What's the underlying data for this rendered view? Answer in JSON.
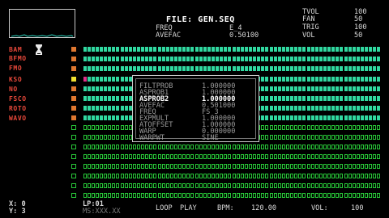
{
  "file": {
    "label": "FILE:",
    "name": "GEN.SEQ"
  },
  "header": {
    "freq_label": "FREQ",
    "freq_value": "E_4",
    "avefac_label": "AVEFAC",
    "avefac_value": "0.50100",
    "tvol_label": "TVOL",
    "tvol_value": "100",
    "fan_label": "FAN",
    "fan_value": "50",
    "trig_label": "TRIG",
    "trig_value": "100",
    "vol_label": "VOL",
    "vol_value": "50"
  },
  "tracks": [
    {
      "name": "BAM",
      "led": "#e07830"
    },
    {
      "name": "BFMO",
      "led": "#e07830"
    },
    {
      "name": "FMO",
      "led": "#e07830"
    },
    {
      "name": "KSO",
      "led": "#f0e030"
    },
    {
      "name": "NO",
      "led": "#e07830"
    },
    {
      "name": "FSCO",
      "led": "#e07830"
    },
    {
      "name": "ROTO",
      "led": "#e07830"
    },
    {
      "name": "WAVO",
      "led": "#e07830"
    }
  ],
  "overlay": {
    "params": [
      {
        "name": "FILTPROB",
        "value": "1.000000"
      },
      {
        "name": "ASPROB1",
        "value": "1.000000"
      },
      {
        "name": "ASPROB2",
        "value": "1.000000",
        "selected": true
      },
      {
        "name": "AVEFAC",
        "value": "0.501000"
      },
      {
        "name": "FREQ",
        "value": "FS 3"
      },
      {
        "name": "EXPMULT",
        "value": "1.000000"
      },
      {
        "name": "ATOFFSET",
        "value": "1.000000"
      },
      {
        "name": "WARP",
        "value": "0.000000"
      },
      {
        "name": "WARPWT",
        "value": "SINE"
      }
    ]
  },
  "cursor": {
    "x_label": "X:",
    "x_value": "0",
    "y_label": "Y:",
    "y_value": "3"
  },
  "status": {
    "lp_label": "LP:",
    "lp_value": "01",
    "ms_label": "MS:",
    "ms_value": "XXX.XX",
    "loop": "LOOP",
    "play": "PLAY",
    "bpm_label": "BPM:",
    "bpm_value": "120.00",
    "vol_label": "VOL:",
    "vol_value": "100"
  },
  "colors": {
    "track_name": "#e8483a",
    "active_cell": "#30d8a0",
    "idle_cell": "#28c838",
    "selected_cell": "#e0308a",
    "hourglass": "#e8e8e8"
  }
}
